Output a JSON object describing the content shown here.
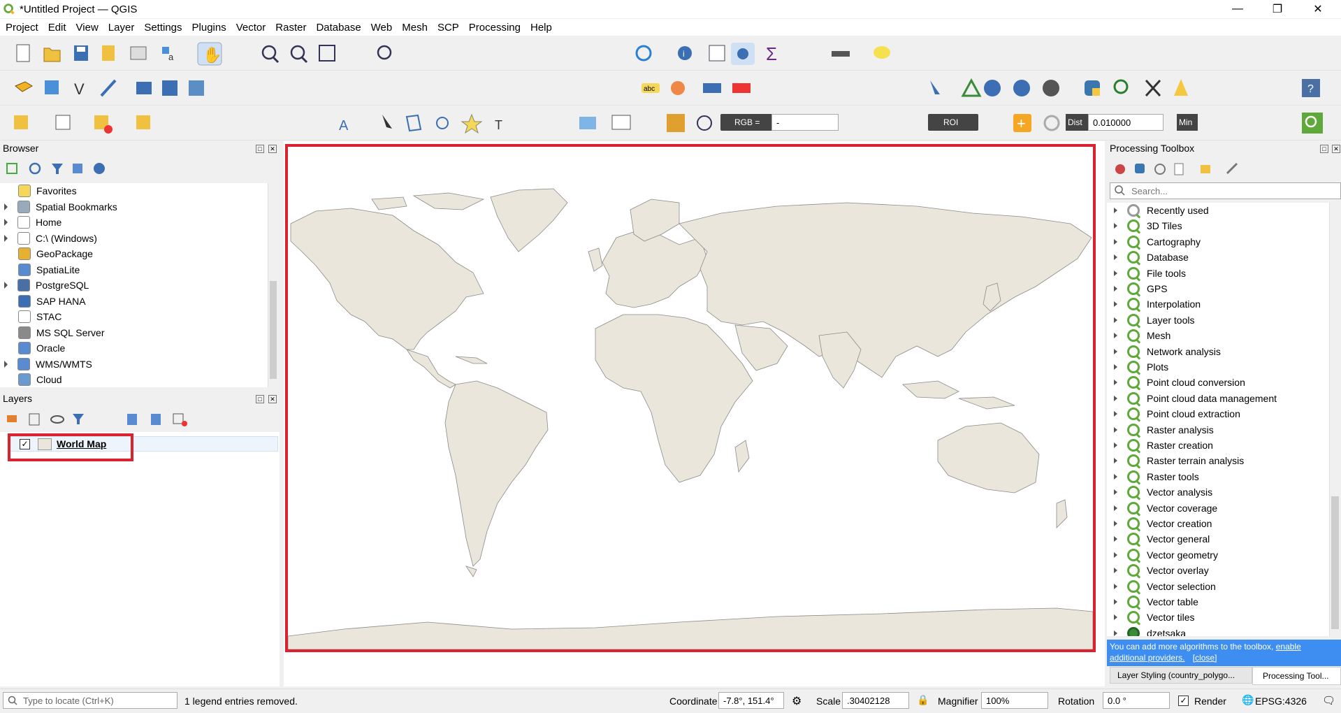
{
  "window": {
    "title": "*Untitled Project — QGIS"
  },
  "menu": [
    "Project",
    "Edit",
    "View",
    "Layer",
    "Settings",
    "Plugins",
    "Vector",
    "Raster",
    "Database",
    "Web",
    "Mesh",
    "SCP",
    "Processing",
    "Help"
  ],
  "toolbar3": {
    "rgb_label": "RGB =",
    "rgb_value": "-",
    "roi_label": "ROI",
    "dist_label": "Dist",
    "dist_value": "0.010000",
    "min_label": "Min"
  },
  "browser": {
    "title": "Browser",
    "items": [
      {
        "label": "Favorites",
        "icon": "star-icon",
        "expandable": false
      },
      {
        "label": "Spatial Bookmarks",
        "icon": "bookmark-icon",
        "expandable": true
      },
      {
        "label": "Home",
        "icon": "home-folder-icon",
        "expandable": true
      },
      {
        "label": "C:\\ (Windows)",
        "icon": "drive-icon",
        "expandable": true
      },
      {
        "label": "GeoPackage",
        "icon": "geopackage-icon",
        "expandable": false
      },
      {
        "label": "SpatiaLite",
        "icon": "spatialite-icon",
        "expandable": false
      },
      {
        "label": "PostgreSQL",
        "icon": "postgresql-icon",
        "expandable": true
      },
      {
        "label": "SAP HANA",
        "icon": "sap-hana-icon",
        "expandable": false
      },
      {
        "label": "STAC",
        "icon": "stac-icon",
        "expandable": false
      },
      {
        "label": "MS SQL Server",
        "icon": "mssql-icon",
        "expandable": false
      },
      {
        "label": "Oracle",
        "icon": "oracle-icon",
        "expandable": false
      },
      {
        "label": "WMS/WMTS",
        "icon": "wms-icon",
        "expandable": true
      },
      {
        "label": "Cloud",
        "icon": "cloud-icon",
        "expandable": false
      }
    ]
  },
  "layers": {
    "title": "Layers",
    "items": [
      {
        "label": "World Map",
        "checked": true,
        "swatch": "#ebe6dc"
      }
    ]
  },
  "toolbox": {
    "title": "Processing Toolbox",
    "search_placeholder": "Search...",
    "items": [
      "Recently used",
      "3D Tiles",
      "Cartography",
      "Database",
      "File tools",
      "GPS",
      "Interpolation",
      "Layer tools",
      "Mesh",
      "Network analysis",
      "Plots",
      "Point cloud conversion",
      "Point cloud data management",
      "Point cloud extraction",
      "Raster analysis",
      "Raster creation",
      "Raster terrain analysis",
      "Raster tools",
      "Vector analysis",
      "Vector coverage",
      "Vector creation",
      "Vector general",
      "Vector geometry",
      "Vector overlay",
      "Vector selection",
      "Vector table",
      "Vector tiles",
      "dzetsaka"
    ],
    "info_text": "You can add more algorithms to the toolbox,",
    "info_link1": "enable",
    "info_link2": "additional providers.",
    "info_close": "[close]",
    "tabs": [
      "Layer Styling (country_polygo...",
      "Processing Tool..."
    ]
  },
  "status": {
    "locate_placeholder": "Type to locate (Ctrl+K)",
    "message": "1 legend entries removed.",
    "coordinate_label": "Coordinate",
    "coordinate_value": "-7.8°, 151.4°",
    "scale_label": "Scale",
    "scale_value": ".30402128",
    "magnifier_label": "Magnifier",
    "magnifier_value": "100%",
    "rotation_label": "Rotation",
    "rotation_value": "0.0 °",
    "render_label": "Render",
    "crs": "EPSG:4326"
  },
  "colors": {
    "highlight": "#d9232e",
    "land": "#ebe6dc",
    "qgis_green": "#5fa83a",
    "info_bg": "#3d8ef0"
  }
}
